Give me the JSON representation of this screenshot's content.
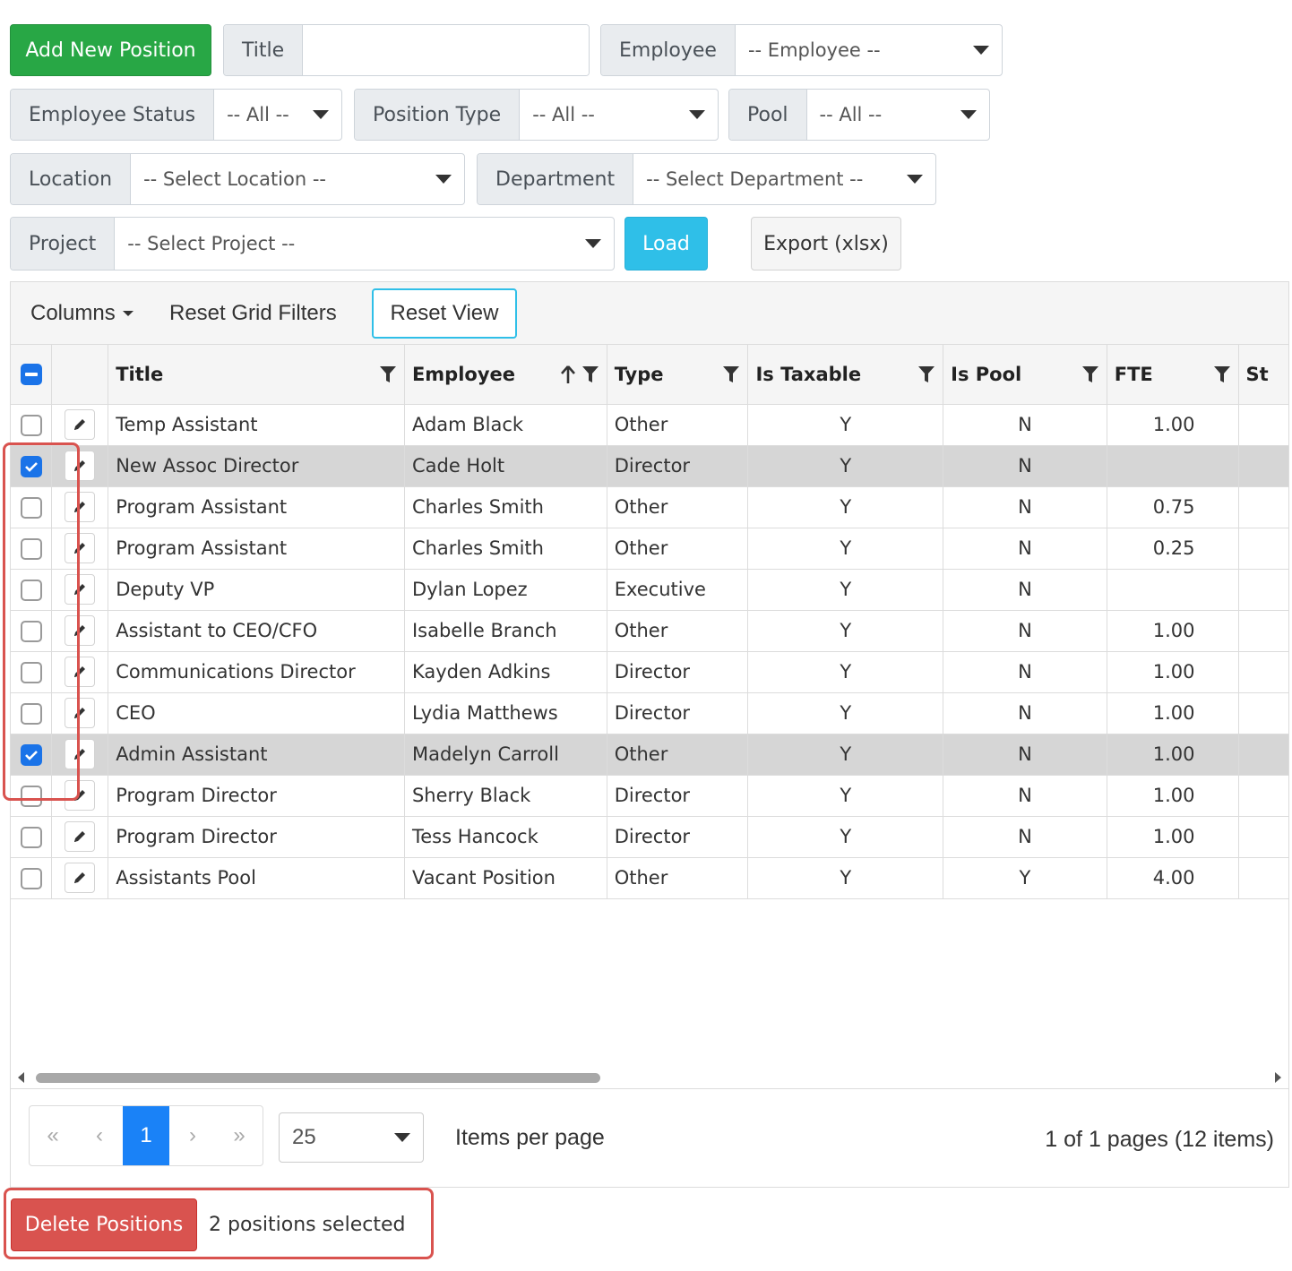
{
  "filters": {
    "add_button": "Add New Position",
    "title_label": "Title",
    "title_value": "",
    "employee_label": "Employee",
    "employee_value": "-- Employee --",
    "status_label": "Employee Status",
    "status_value": "-- All --",
    "position_type_label": "Position Type",
    "position_type_value": "-- All --",
    "pool_label": "Pool",
    "pool_value": "-- All --",
    "location_label": "Location",
    "location_value": "-- Select Location --",
    "department_label": "Department",
    "department_value": "-- Select Department --",
    "project_label": "Project",
    "project_value": "-- Select Project --",
    "load_button": "Load",
    "export_button": "Export (xlsx)"
  },
  "toolbar": {
    "columns": "Columns",
    "reset_filters": "Reset Grid Filters",
    "reset_view": "Reset View"
  },
  "columns": {
    "title": "Title",
    "employee": "Employee",
    "type": "Type",
    "is_taxable": "Is Taxable",
    "is_pool": "Is Pool",
    "fte": "FTE",
    "status_partial": "St"
  },
  "rows": [
    {
      "selected": false,
      "title": "Temp Assistant",
      "employee": "Adam Black",
      "type": "Other",
      "taxable": "Y",
      "pool": "N",
      "fte": "1.00"
    },
    {
      "selected": true,
      "title": "New Assoc Director",
      "employee": "Cade Holt",
      "type": "Director",
      "taxable": "Y",
      "pool": "N",
      "fte": ""
    },
    {
      "selected": false,
      "title": "Program Assistant",
      "employee": "Charles Smith",
      "type": "Other",
      "taxable": "Y",
      "pool": "N",
      "fte": "0.75"
    },
    {
      "selected": false,
      "title": "Program Assistant",
      "employee": "Charles Smith",
      "type": "Other",
      "taxable": "Y",
      "pool": "N",
      "fte": "0.25"
    },
    {
      "selected": false,
      "title": "Deputy VP",
      "employee": "Dylan Lopez",
      "type": "Executive",
      "taxable": "Y",
      "pool": "N",
      "fte": ""
    },
    {
      "selected": false,
      "title": "Assistant to CEO/CFO",
      "employee": "Isabelle Branch",
      "type": "Other",
      "taxable": "Y",
      "pool": "N",
      "fte": "1.00"
    },
    {
      "selected": false,
      "title": "Communications Director",
      "employee": "Kayden Adkins",
      "type": "Director",
      "taxable": "Y",
      "pool": "N",
      "fte": "1.00"
    },
    {
      "selected": false,
      "title": "CEO",
      "employee": "Lydia Matthews",
      "type": "Director",
      "taxable": "Y",
      "pool": "N",
      "fte": "1.00"
    },
    {
      "selected": true,
      "title": "Admin Assistant",
      "employee": "Madelyn Carroll",
      "type": "Other",
      "taxable": "Y",
      "pool": "N",
      "fte": "1.00"
    },
    {
      "selected": false,
      "title": "Program Director",
      "employee": "Sherry Black",
      "type": "Director",
      "taxable": "Y",
      "pool": "N",
      "fte": "1.00"
    },
    {
      "selected": false,
      "title": "Program Director",
      "employee": "Tess Hancock",
      "type": "Director",
      "taxable": "Y",
      "pool": "N",
      "fte": "1.00"
    },
    {
      "selected": false,
      "title": "Assistants Pool",
      "employee": "Vacant Position",
      "type": "Other",
      "taxable": "Y",
      "pool": "Y",
      "fte": "4.00"
    }
  ],
  "pager": {
    "first": "«",
    "prev": "‹",
    "current": "1",
    "next": "›",
    "last": "»",
    "page_size": "25",
    "items_per_page": "Items per page",
    "info": "1 of 1 pages (12 items)"
  },
  "footer": {
    "delete_button": "Delete Positions",
    "selected_text": "2 positions selected"
  },
  "colors": {
    "green": "#28a745",
    "info": "#2fbfe8",
    "danger": "#d9534f",
    "primary": "#1a73e8"
  }
}
